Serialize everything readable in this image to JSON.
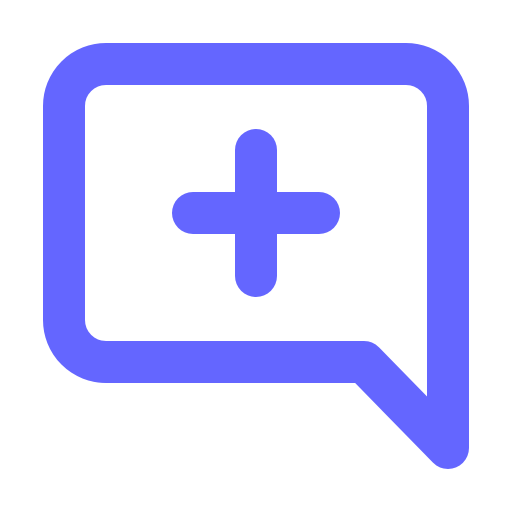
{
  "icon": {
    "name": "add-comment-icon",
    "shape": "speech bubble with plus",
    "color": "#6466FF",
    "background": "#FFFFFF"
  }
}
